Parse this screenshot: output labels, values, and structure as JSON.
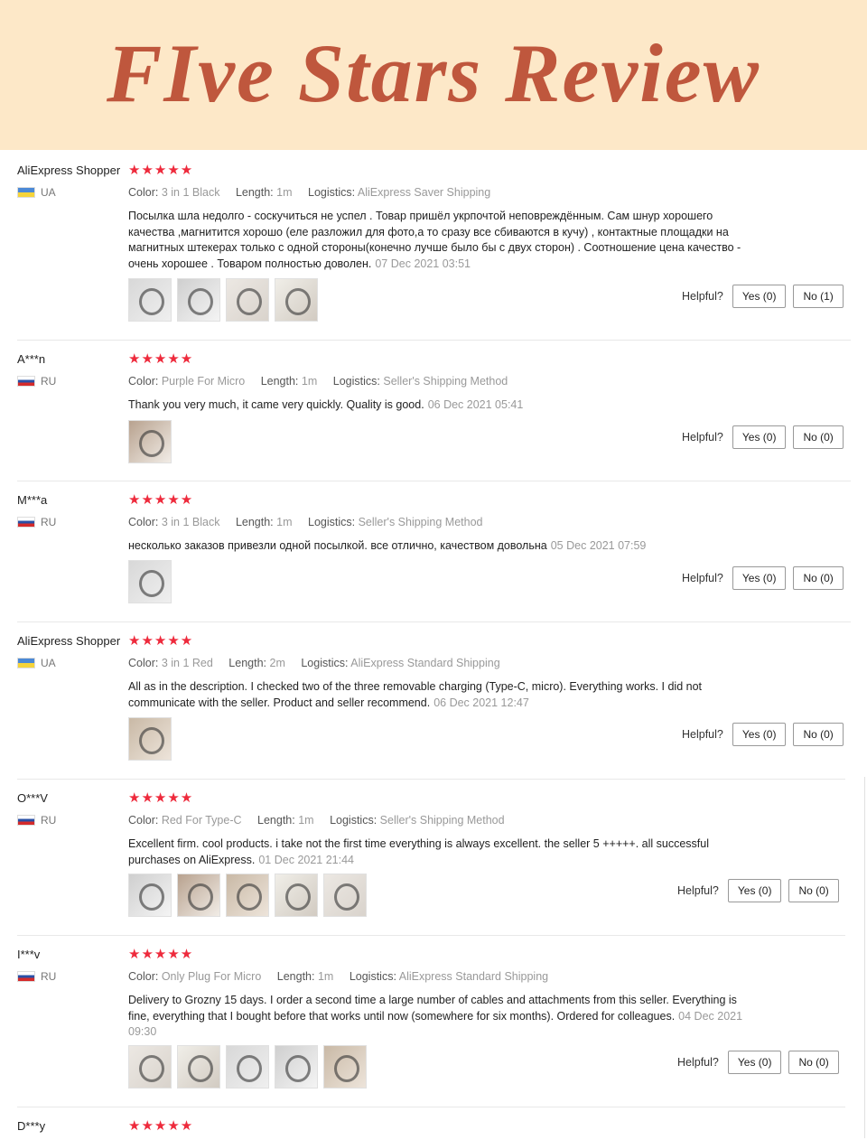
{
  "banner": {
    "title": "FIve Stars Review"
  },
  "colors": {
    "banner_bg": "#fde8c8",
    "title": "#bf573d",
    "stars": "#ee2a3c"
  },
  "labels": {
    "color": "Color:",
    "length": "Length:",
    "logistics": "Logistics:",
    "helpful": "Helpful?"
  },
  "reviews": [
    {
      "name": "AliExpress Shopper",
      "country": "UA",
      "flag": "ua",
      "stars": "★★★★★",
      "rating": 5,
      "color": "3 in 1 Black",
      "length": "1m",
      "logistics": "AliExpress Saver Shipping",
      "text": "Посылка шла недолго - соскучиться не успел . Товар пришёл укрпочтой неповреждённым. Сам шнур хорошего качества ,магнитится хорошо (еле разложил для фото,а то сразу все сбиваются в кучу) , контактные площадки на магнитных штекерах только с одной стороны(конечно лучше было бы с двух сторон) . Соотношение цена качество - очень хорошее . Товаром полностью доволен.",
      "date": "07 Dec 2021 03:51",
      "yes": "Yes (0)",
      "no": "No (1)"
    },
    {
      "name": "A***n",
      "country": "RU",
      "flag": "ru",
      "stars": "★★★★★",
      "rating": 5,
      "color": "Purple For Micro",
      "length": "1m",
      "logistics": "Seller's Shipping Method",
      "text": "Thank you very much, it came very quickly. Quality is good.",
      "date": "06 Dec 2021 05:41",
      "yes": "Yes (0)",
      "no": "No (0)"
    },
    {
      "name": "M***a",
      "country": "RU",
      "flag": "ru",
      "stars": "★★★★★",
      "rating": 5,
      "color": "3 in 1 Black",
      "length": "1m",
      "logistics": "Seller's Shipping Method",
      "text": "несколько заказов привезли одной посылкой. все отлично, качеством довольна",
      "date": "05 Dec 2021 07:59",
      "yes": "Yes (0)",
      "no": "No (0)"
    },
    {
      "name": "AliExpress Shopper",
      "country": "UA",
      "flag": "ua",
      "stars": "★★★★★",
      "rating": 5,
      "color": "3 in 1 Red",
      "length": "2m",
      "logistics": "AliExpress Standard Shipping",
      "text": "All as in the description. I checked two of the three removable charging (Type-C, micro). Everything works. I did not communicate with the seller. Product and seller recommend.",
      "date": "06 Dec 2021 12:47",
      "yes": "Yes (0)",
      "no": "No (0)"
    },
    {
      "name": "O***V",
      "country": "RU",
      "flag": "ru",
      "stars": "★★★★★",
      "rating": 5,
      "color": "Red For Type-C",
      "length": "1m",
      "logistics": "Seller's Shipping Method",
      "text": "Excellent firm. cool products. i take not the first time everything is always excellent. the seller 5 +++++. all successful purchases on AliExpress.",
      "date": "01 Dec 2021 21:44",
      "yes": "Yes (0)",
      "no": "No (0)"
    },
    {
      "name": "I***v",
      "country": "RU",
      "flag": "ru",
      "stars": "★★★★★",
      "rating": 5,
      "color": "Only Plug For Micro",
      "length": "1m",
      "logistics": "AliExpress Standard Shipping",
      "text": "Delivery to Grozny 15 days. I order a second time a large number of cables and attachments from this seller. Everything is fine, everything that I bought before that works until now (somewhere for six months). Ordered for colleagues.",
      "date": "04 Dec 2021 09:30",
      "yes": "Yes (0)",
      "no": "No (0)"
    },
    {
      "name": "D***y",
      "stars": "★★★★★",
      "rating": 5
    }
  ]
}
